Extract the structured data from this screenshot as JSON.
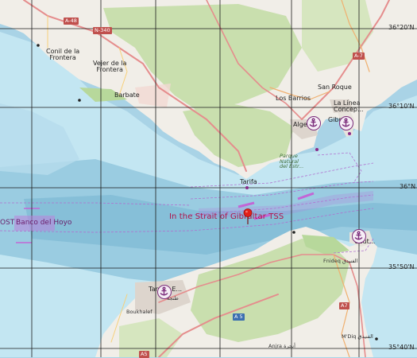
{
  "map": {
    "coords": {
      "lat_36_20": "36°20'N",
      "lat_36_10": "36°10'N",
      "lat_36_00": "36°N",
      "lat_35_50": "35°50'N",
      "lat_35_40": "35°40'N"
    },
    "roads": {
      "a48": "A-48",
      "n340": "N-340",
      "a7": "A-7",
      "a7_south": "A7",
      "a5": "A 5",
      "a5_b": "A5"
    },
    "places": {
      "conil": "Conil de la\nFrontera",
      "vejer": "Vejer de la\nFrontera",
      "barbate": "Barbate",
      "los_barrios": "Los Barrios",
      "san_roque": "San Roque",
      "la_linea": "La Línea\nConcep...",
      "algeciras": "Algec...",
      "gibraltar": "Gibr...",
      "tarifa": "Tarifa",
      "parque": "Parque\nNatural\ndel Estr...",
      "ceuta": "Ceut...",
      "fnideq": "Fnideq الفنيدق",
      "tanger": "Tanger E...",
      "tanger_ar": "طنجة",
      "boukhalef": "Boukhalef",
      "anjra": "Anjra أنجرة",
      "mdiq": "M'Diq الفنيدق"
    },
    "labels": {
      "strait": "In the Strait of Gibraltar TSS",
      "banco": "Banco del Hoyo",
      "ost": "OST"
    },
    "colors": {
      "sea_deep": "#a9d3e6",
      "sea_shallow": "#c3e6f2",
      "land": "#f1eee8",
      "forest": "#c9dfae",
      "tss_magenta": "#b0124a",
      "anchorage": "#7b2c7b",
      "pin": "#e3211a",
      "grid": "#1c1c1c"
    },
    "icons": [
      "anchor-icon",
      "location-pin-icon"
    ]
  }
}
